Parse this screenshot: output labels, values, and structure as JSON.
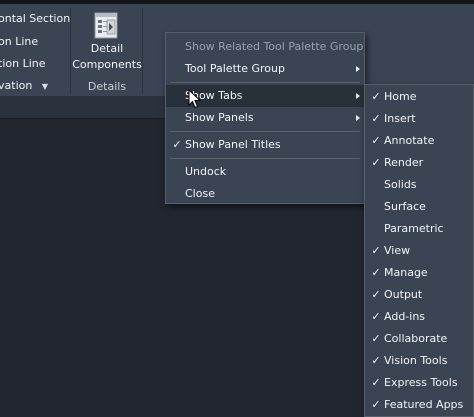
{
  "ribbon": {
    "left_items": [
      {
        "label": "ontal Section",
        "caret": false
      },
      {
        "label": "on Line",
        "caret": false
      },
      {
        "label": "tion Line",
        "caret": false
      },
      {
        "label": "vation",
        "caret": true
      }
    ],
    "detail_button": {
      "line1": "Detail",
      "line2": "Components",
      "icon": "detail-components-icon"
    },
    "panel_title": "Details"
  },
  "context_menu": {
    "items": [
      {
        "label": "Show Related Tool Palette Group",
        "disabled": true,
        "checked": false,
        "submenu": false
      },
      {
        "label": "Tool Palette Group",
        "disabled": false,
        "checked": false,
        "submenu": true
      },
      {
        "separator": true
      },
      {
        "label": "Show Tabs",
        "disabled": false,
        "checked": false,
        "submenu": true,
        "hover": true
      },
      {
        "label": "Show Panels",
        "disabled": false,
        "checked": false,
        "submenu": true
      },
      {
        "separator": true
      },
      {
        "label": "Show Panel Titles",
        "disabled": false,
        "checked": true,
        "submenu": false
      },
      {
        "separator": true
      },
      {
        "label": "Undock",
        "disabled": false,
        "checked": false,
        "submenu": false
      },
      {
        "label": "Close",
        "disabled": false,
        "checked": false,
        "submenu": false
      }
    ]
  },
  "tabs_submenu": {
    "items": [
      {
        "label": "Home",
        "checked": true
      },
      {
        "label": "Insert",
        "checked": true
      },
      {
        "label": "Annotate",
        "checked": true
      },
      {
        "label": "Render",
        "checked": true
      },
      {
        "label": "Solids",
        "checked": false
      },
      {
        "label": "Surface",
        "checked": false
      },
      {
        "label": "Parametric",
        "checked": false
      },
      {
        "label": "View",
        "checked": true
      },
      {
        "label": "Manage",
        "checked": true
      },
      {
        "label": "Output",
        "checked": true
      },
      {
        "label": "Add-ins",
        "checked": true
      },
      {
        "label": "Collaborate",
        "checked": true
      },
      {
        "label": "Vision Tools",
        "checked": true
      },
      {
        "label": "Express Tools",
        "checked": true
      },
      {
        "label": "Featured Apps",
        "checked": true
      }
    ]
  },
  "glyphs": {
    "check": "✓",
    "caret": "▼"
  },
  "colors": {
    "ribbon": "#3b4453",
    "menu": "#3b4453",
    "hover": "#27303b",
    "background": "#1f232b",
    "disabled_text": "#9aa1ac"
  }
}
